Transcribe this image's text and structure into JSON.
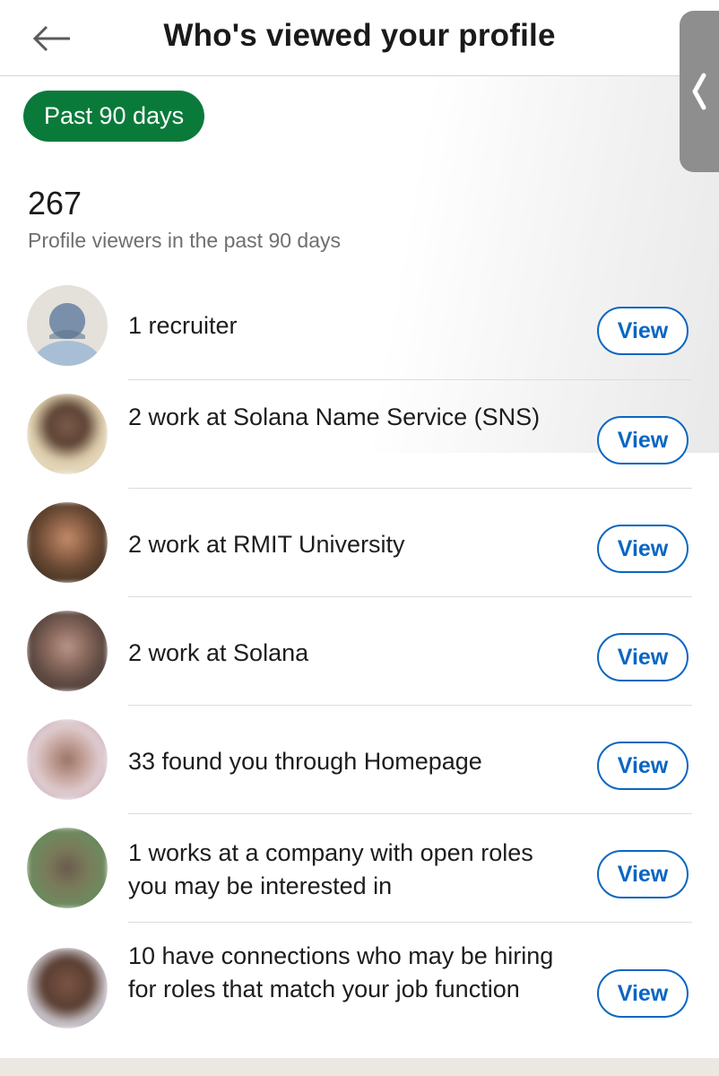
{
  "header": {
    "title": "Who's viewed your profile",
    "back_icon": "arrow-left-icon"
  },
  "side_handle": {
    "icon": "chevron-left-icon"
  },
  "filter": {
    "label": "Past 90 days",
    "color": "#0a7a3b"
  },
  "summary": {
    "count": "267",
    "subtitle": "Profile viewers in the past 90 days"
  },
  "viewer_groups": [
    {
      "text": "1 recruiter",
      "button": "View",
      "avatar": "default-person-icon"
    },
    {
      "text": "2 work at Solana Name Service (SNS)",
      "button": "View",
      "avatar": "blurred-photo"
    },
    {
      "text": "2 work at RMIT University",
      "button": "View",
      "avatar": "blurred-photo"
    },
    {
      "text": "2 work at Solana",
      "button": "View",
      "avatar": "blurred-photo"
    },
    {
      "text": "33 found you through Homepage",
      "button": "View",
      "avatar": "blurred-photo"
    },
    {
      "text": "1 works at a company with open roles you may be interested in",
      "button": "View",
      "avatar": "blurred-photo"
    },
    {
      "text": "10 have connections who may be hiring for roles that match your job function",
      "button": "View",
      "avatar": "blurred-photo"
    }
  ],
  "colors": {
    "accent_blue": "#0a66c2",
    "pill_green": "#0a7a3b"
  }
}
